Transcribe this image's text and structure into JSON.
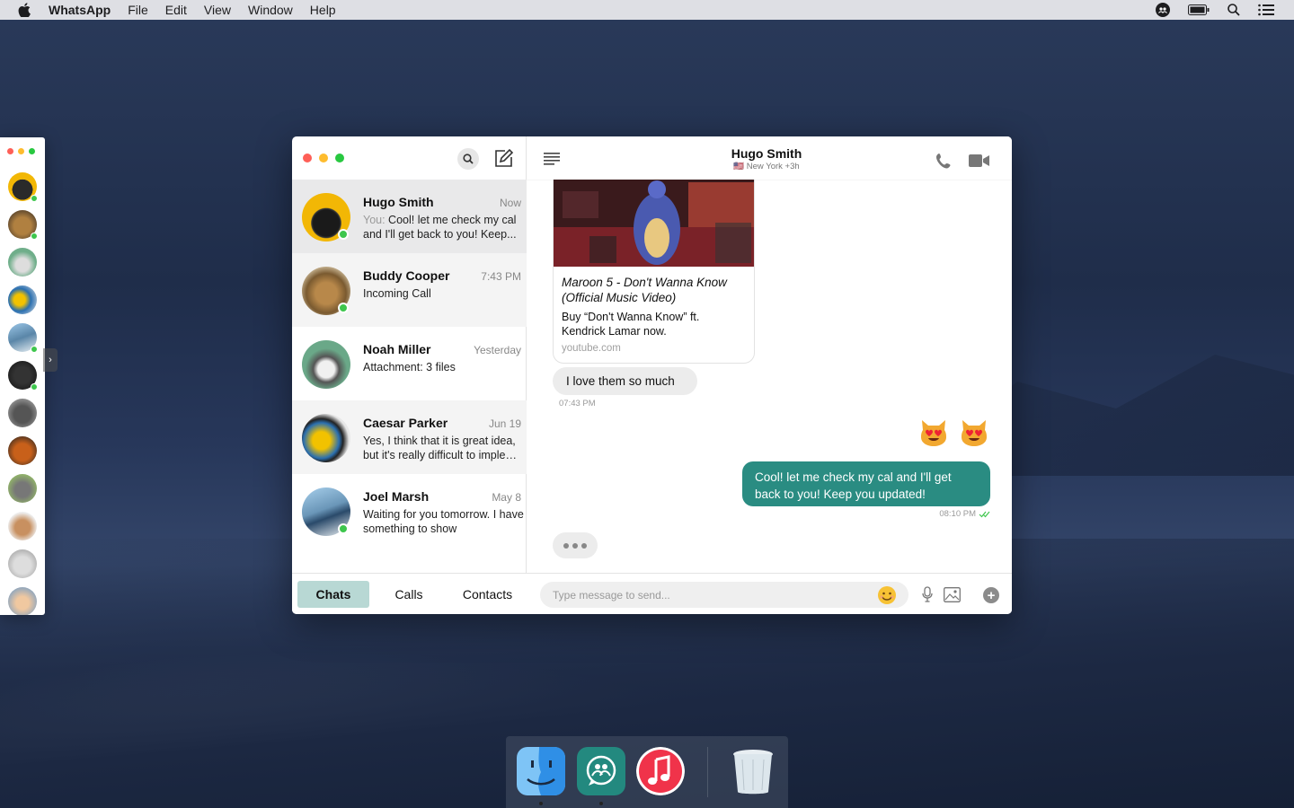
{
  "menubar": {
    "app_name": "WhatsApp",
    "items": [
      "File",
      "Edit",
      "View",
      "Window",
      "Help"
    ]
  },
  "colors": {
    "accent": "#2a8c82",
    "tab_active": "#b8d8d4",
    "online": "#3ec64d",
    "traffic_red": "#fe5f57",
    "traffic_yellow": "#febc2e",
    "traffic_green": "#28c840"
  },
  "sidebar": {
    "search_icon": "search-icon",
    "compose_icon": "compose-icon"
  },
  "chats": [
    {
      "name": "Hugo Smith",
      "time": "Now",
      "prefix": "You:",
      "preview": " Cool! let me check my cal and I'll get back to you! Keep...",
      "online": true
    },
    {
      "name": "Buddy Cooper",
      "time": "7:43 PM",
      "preview": "Incoming Call",
      "online": true
    },
    {
      "name": "Noah Miller",
      "time": "Yesterday",
      "preview": "Attachment: 3 files",
      "online": false
    },
    {
      "name": "Caesar Parker",
      "time": "Jun 19",
      "preview": "Yes, I think that it is great idea, but it's really difficult to imple…",
      "online": false
    },
    {
      "name": "Joel Marsh",
      "time": "May 8",
      "preview": "Waiting for you tomorrow. I have something to show",
      "online": true
    }
  ],
  "tabs": [
    "Chats",
    "Calls",
    "Contacts"
  ],
  "conversation": {
    "title": "Hugo Smith",
    "subtitle": "🇺🇸 New York +3h",
    "link_card": {
      "title": "Maroon 5 - Don't Wanna Know (Official Music Video)",
      "description": "Buy “Don't Wanna Know” ft. Kendrick Lamar now.",
      "domain": "youtube.com"
    },
    "incoming_text": "I love them so much",
    "incoming_time": "07:43 PM",
    "outgoing_text": "Cool! let me check my cal and I'll get back to you! Keep you updated!",
    "outgoing_time": "08:10 PM"
  },
  "composer": {
    "placeholder": "Type message to send..."
  },
  "dock": [
    "Finder",
    "WhatsApp",
    "iTunes",
    "Trash"
  ]
}
